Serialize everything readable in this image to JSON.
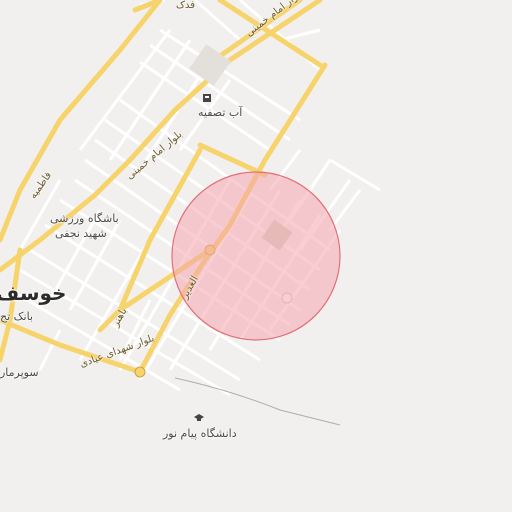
{
  "labels": {
    "water_treatment": "آب تصفیه",
    "blvd_khomeini_top": "بلوار امام خمینی",
    "blvd_khomeini_mid": "بلوار امام خمینی",
    "gym_line1": "باشگاه ورزشی",
    "gym_line2": "شهید نجفی",
    "city": "خوسف",
    "bank": "بانک تج",
    "blvd_shohada": "بلوار شهدای عیادی",
    "supermarket": "سوپرمار",
    "university": "دانشگاه پیام نور",
    "ghadir": "الغدیر",
    "street_top": "فدک",
    "bahonar": "باهنر",
    "street_left": "فاطمیه"
  },
  "colors": {
    "background": "#f2f0ee",
    "major_road": "#f6d36b",
    "minor_road": "#ffffff",
    "circle_fill": "#f4a6ae",
    "circle_stroke": "#e0707c"
  },
  "icons": {
    "water_treatment": "building-icon",
    "university": "graduation-cap-icon"
  }
}
